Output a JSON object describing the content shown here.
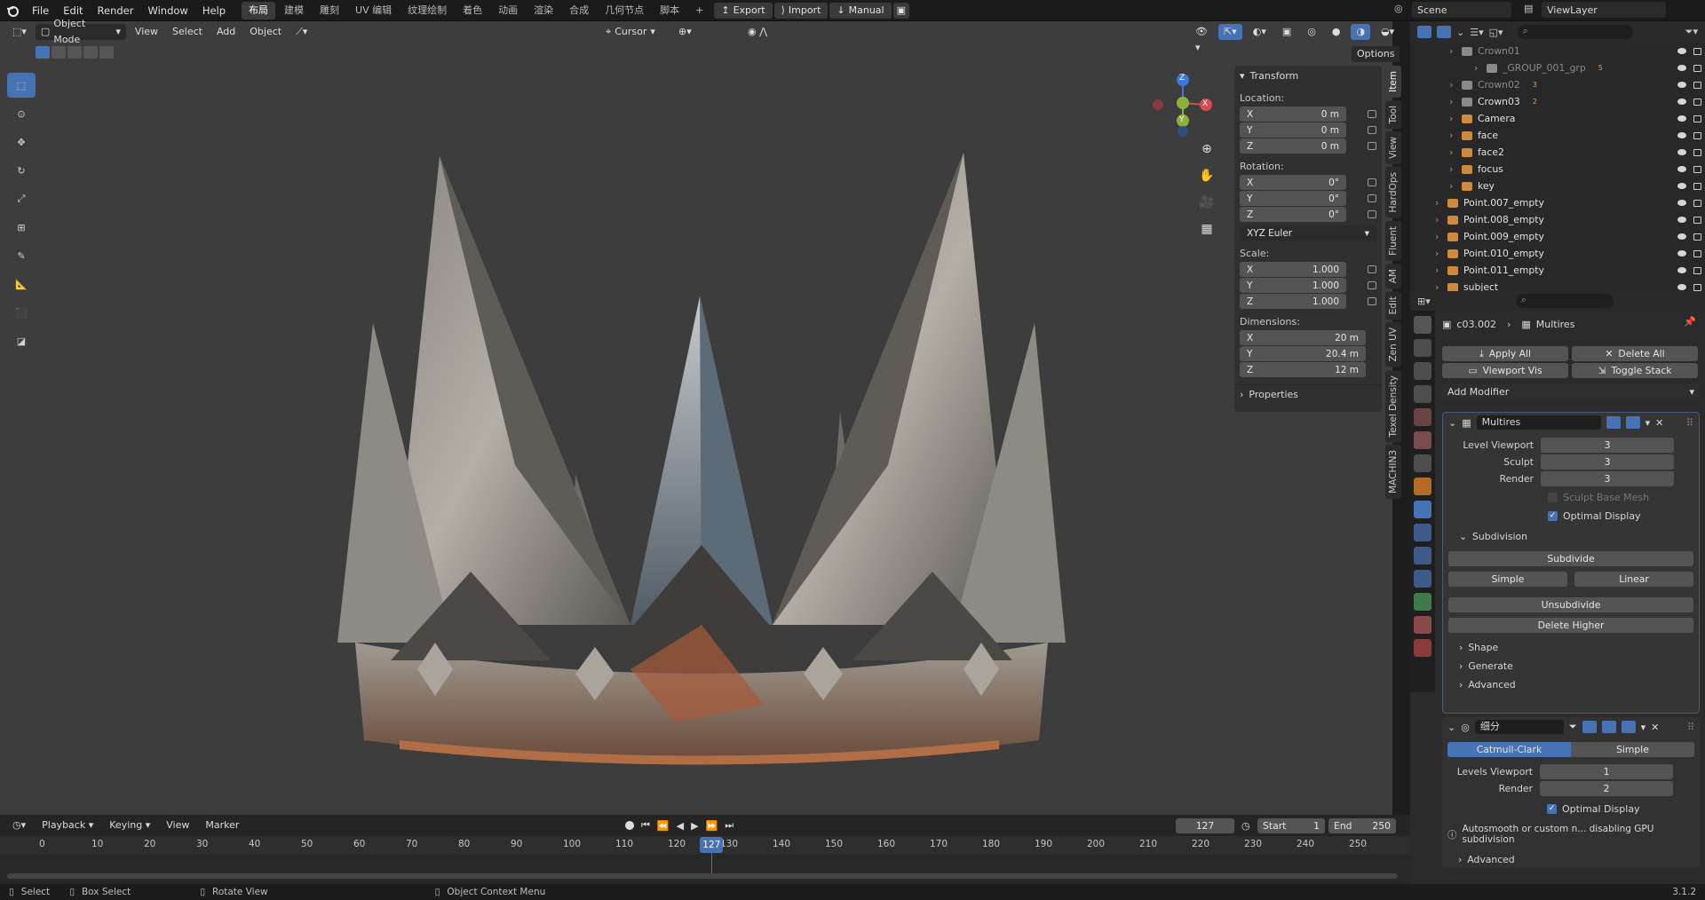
{
  "topbar": {
    "menus": [
      "File",
      "Edit",
      "Render",
      "Window",
      "Help"
    ],
    "workspaces": [
      "布局",
      "建模",
      "雕刻",
      "UV 编辑",
      "纹理绘制",
      "着色",
      "动画",
      "渲染",
      "合成",
      "几何节点",
      "脚本"
    ],
    "active_workspace": "布局",
    "export": "Export",
    "import": "Import",
    "manual": "Manual",
    "scene": "Scene",
    "viewlayer": "ViewLayer",
    "add_tab": "+"
  },
  "viewport_header": {
    "mode": "Object Mode",
    "menus": [
      "View",
      "Select",
      "Add",
      "Object"
    ],
    "pivot": "Cursor",
    "options": "Options"
  },
  "gizmo": {
    "x": "X",
    "y": "Y",
    "z": "Z"
  },
  "npanel": {
    "title": "Transform",
    "location_label": "Location:",
    "location": [
      {
        "axis": "X",
        "value": "0 m"
      },
      {
        "axis": "Y",
        "value": "0 m"
      },
      {
        "axis": "Z",
        "value": "0 m"
      }
    ],
    "rotation_label": "Rotation:",
    "rotation": [
      {
        "axis": "X",
        "value": "0°"
      },
      {
        "axis": "Y",
        "value": "0°"
      },
      {
        "axis": "Z",
        "value": "0°"
      }
    ],
    "rotation_mode": "XYZ Euler",
    "scale_label": "Scale:",
    "scale": [
      {
        "axis": "X",
        "value": "1.000"
      },
      {
        "axis": "Y",
        "value": "1.000"
      },
      {
        "axis": "Z",
        "value": "1.000"
      }
    ],
    "dimensions_label": "Dimensions:",
    "dimensions": [
      {
        "axis": "X",
        "value": "20 m"
      },
      {
        "axis": "Y",
        "value": "20.4 m"
      },
      {
        "axis": "Z",
        "value": "12 m"
      }
    ],
    "properties": "Properties",
    "tabs": [
      "Item",
      "Tool",
      "View",
      "HardOps",
      "Fluent",
      "AM",
      "Edit",
      "Zen UV",
      "Texel Density",
      "MACHIN3"
    ]
  },
  "outliner": {
    "rows": [
      {
        "name": "Crown01",
        "dim": true
      },
      {
        "name": "_GROUP_001_grp",
        "dim": true,
        "badge": "5"
      },
      {
        "name": "Crown02",
        "dim": true,
        "badge": "3"
      },
      {
        "name": "Crown03",
        "dim": false,
        "badge": "2"
      },
      {
        "name": "Camera",
        "dim": false
      },
      {
        "name": "face",
        "dim": false
      },
      {
        "name": "face2",
        "dim": false
      },
      {
        "name": "focus",
        "dim": false
      },
      {
        "name": "key",
        "dim": false
      },
      {
        "name": "Point.007_empty",
        "dim": false
      },
      {
        "name": "Point.008_empty",
        "dim": false
      },
      {
        "name": "Point.009_empty",
        "dim": false
      },
      {
        "name": "Point.010_empty",
        "dim": false
      },
      {
        "name": "Point.011_empty",
        "dim": false
      },
      {
        "name": "subject",
        "dim": false
      }
    ]
  },
  "properties": {
    "object": "c03.002",
    "context": "Multires",
    "apply_all": "Apply All",
    "delete_all": "Delete All",
    "viewport_vis": "Viewport Vis",
    "toggle_stack": "Toggle Stack",
    "add_modifier": "Add Modifier",
    "multires": {
      "name": "Multires",
      "level_viewport_label": "Level Viewport",
      "level_viewport": "3",
      "sculpt_label": "Sculpt",
      "sculpt": "3",
      "render_label": "Render",
      "render": "3",
      "sculpt_base_mesh": "Sculpt Base Mesh",
      "optimal_display": "Optimal Display",
      "subdivision": "Subdivision",
      "subdivide": "Subdivide",
      "simple": "Simple",
      "linear": "Linear",
      "unsubdivide": "Unsubdivide",
      "delete_higher": "Delete Higher",
      "shape": "Shape",
      "generate": "Generate",
      "advanced": "Advanced"
    },
    "subsurf": {
      "name": "细分",
      "catmull": "Catmull-Clark",
      "simple": "Simple",
      "levels_viewport_label": "Levels Viewport",
      "levels_viewport": "1",
      "render_label": "Render",
      "render": "2",
      "optimal_display": "Optimal Display",
      "warning": "Autosmooth or custom n... disabling GPU subdivision",
      "advanced": "Advanced"
    }
  },
  "timeline": {
    "menus": [
      "Playback",
      "Keying",
      "View",
      "Marker"
    ],
    "current_frame": "127",
    "start_label": "Start",
    "start": "1",
    "end_label": "End",
    "end": "250",
    "ticks": [
      "0",
      "10",
      "20",
      "30",
      "40",
      "50",
      "60",
      "70",
      "80",
      "90",
      "100",
      "110",
      "120",
      "130",
      "140",
      "150",
      "160",
      "170",
      "180",
      "190",
      "200",
      "210",
      "220",
      "230",
      "240",
      "250"
    ]
  },
  "statusbar": {
    "select": "Select",
    "box_select": "Box Select",
    "rotate_view": "Rotate View",
    "context_menu": "Object Context Menu",
    "version": "3.1.2"
  },
  "colors": {
    "accent": "#4772b3",
    "header": "#1b1b1b",
    "viewport": "#3d3d3d",
    "panel": "#303030"
  }
}
